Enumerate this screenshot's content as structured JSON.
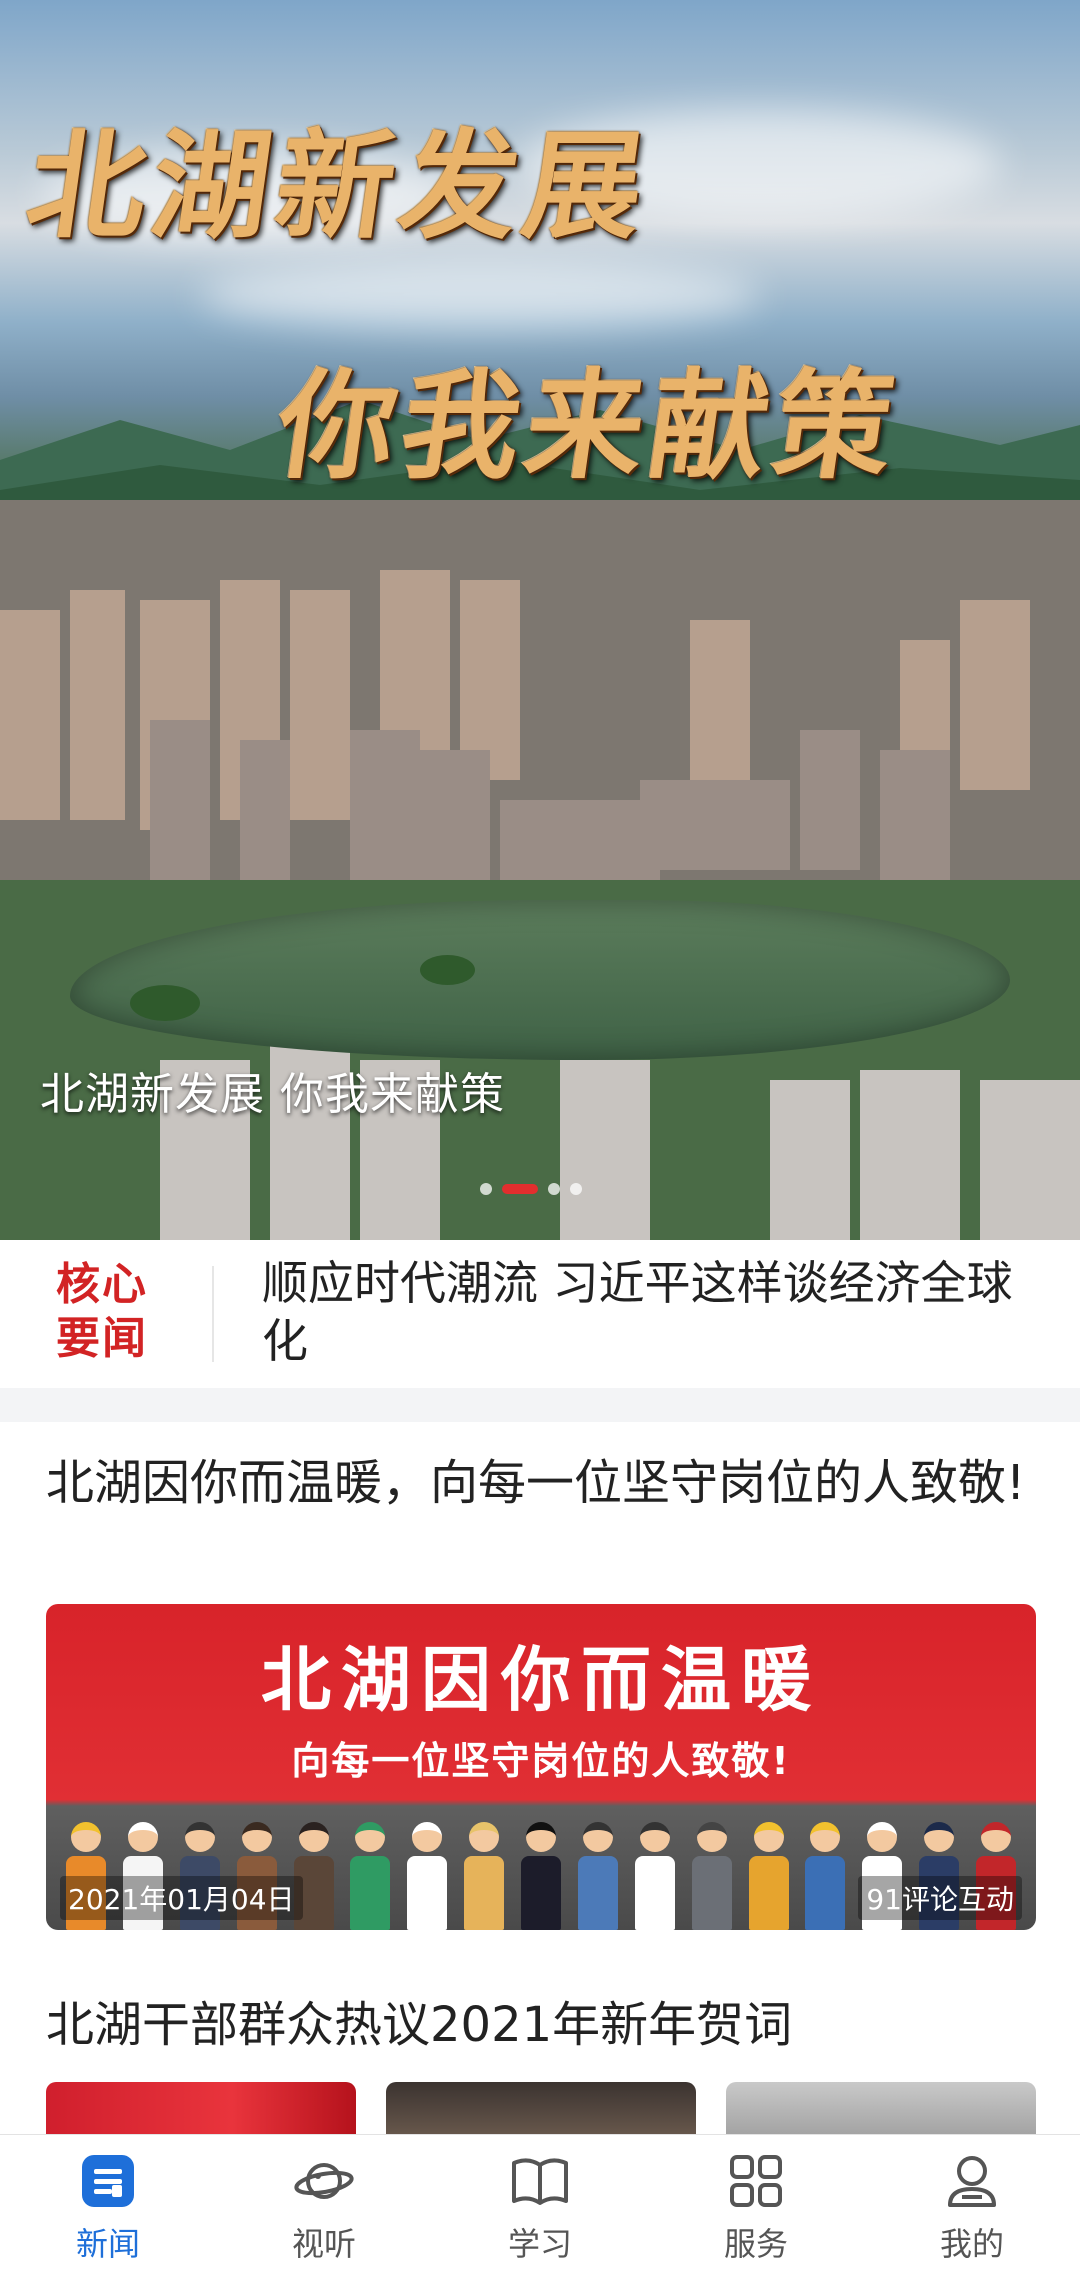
{
  "hero": {
    "calligraphy_line1": "北湖新发展",
    "calligraphy_line2": "你我来献策",
    "caption": "北湖新发展 你我来献策",
    "slide_count": 4,
    "active_slide": 1
  },
  "core_news": {
    "tag_line1": "核心",
    "tag_line2": "要闻",
    "headline": "顺应时代潮流 习近平这样谈经济全球化"
  },
  "articles": [
    {
      "title": "北湖因你而温暖，向每一位坚守岗位的人致敬!",
      "banner_title": "北湖因你而温暖",
      "banner_subtitle": "向每一位坚守岗位的人致敬!",
      "date": "2021年01月04日",
      "comments": "91评论互动"
    },
    {
      "title": "北湖干部群众热议2021年新年贺词"
    }
  ],
  "tabbar": {
    "items": [
      {
        "label": "新闻",
        "icon": "news-icon",
        "active": true
      },
      {
        "label": "视听",
        "icon": "planet-icon",
        "active": false
      },
      {
        "label": "学习",
        "icon": "book-icon",
        "active": false
      },
      {
        "label": "服务",
        "icon": "grid-icon",
        "active": false
      },
      {
        "label": "我的",
        "icon": "profile-icon",
        "active": false
      }
    ]
  },
  "colors": {
    "accent_red": "#d22324",
    "accent_blue": "#1e6fd9"
  }
}
